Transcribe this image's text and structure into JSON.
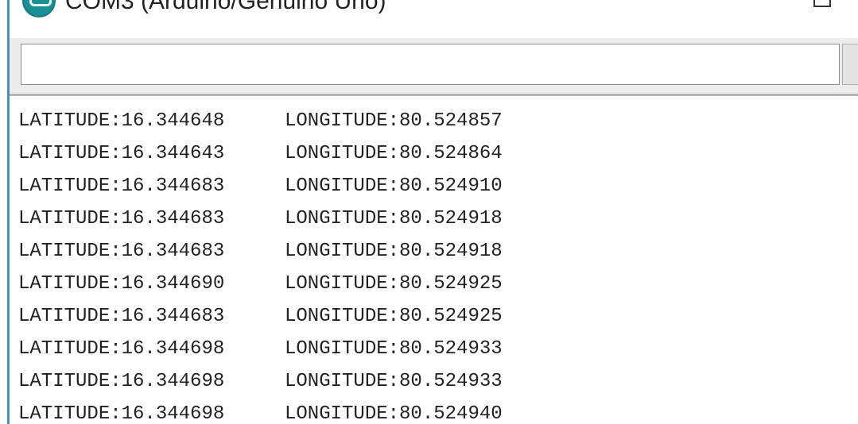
{
  "window": {
    "title": "COM3 (Arduino/Genuino Uno)"
  },
  "input": {
    "value": "",
    "placeholder": ""
  },
  "serial_output": [
    {
      "latitude": "LATITUDE:16.344648",
      "longitude": "LONGITUDE:80.524857"
    },
    {
      "latitude": "LATITUDE:16.344643",
      "longitude": "LONGITUDE:80.524864"
    },
    {
      "latitude": "LATITUDE:16.344683",
      "longitude": "LONGITUDE:80.524910"
    },
    {
      "latitude": "LATITUDE:16.344683",
      "longitude": "LONGITUDE:80.524918"
    },
    {
      "latitude": "LATITUDE:16.344683",
      "longitude": "LONGITUDE:80.524918"
    },
    {
      "latitude": "LATITUDE:16.344690",
      "longitude": "LONGITUDE:80.524925"
    },
    {
      "latitude": "LATITUDE:16.344683",
      "longitude": "LONGITUDE:80.524925"
    },
    {
      "latitude": "LATITUDE:16.344698",
      "longitude": "LONGITUDE:80.524933"
    },
    {
      "latitude": "LATITUDE:16.344698",
      "longitude": "LONGITUDE:80.524933"
    },
    {
      "latitude": "LATITUDE:16.344698",
      "longitude": "LONGITUDE:80.524940"
    }
  ],
  "icons": {
    "app": "arduino-icon",
    "maximize": "maximize-icon"
  },
  "colors": {
    "accent": "#4a8fc4",
    "app_icon": "#1a8f96",
    "text": "#222222",
    "toolbar_bg": "#ececec"
  }
}
